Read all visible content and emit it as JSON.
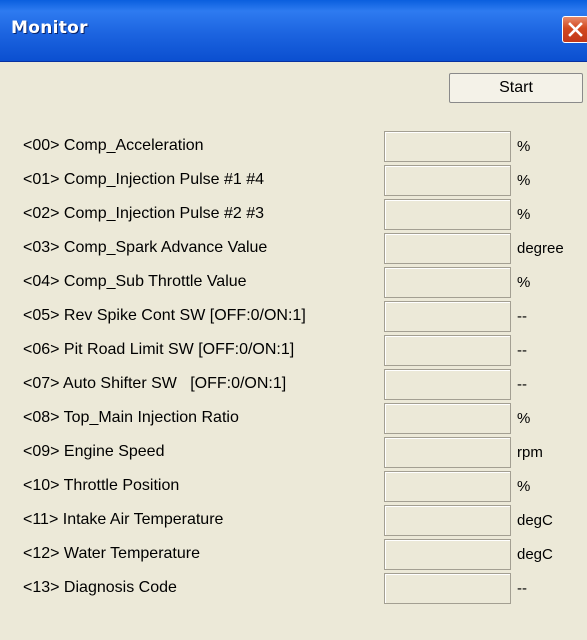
{
  "window": {
    "title": "Monitor",
    "close_icon": "close-icon",
    "accent_color": "#1c64e0",
    "close_color": "#d2491f"
  },
  "toolbar": {
    "start_label": "Start"
  },
  "monitor": {
    "rows": [
      {
        "label": "<00> Comp_Acceleration",
        "value": "",
        "unit": "%"
      },
      {
        "label": "<01> Comp_Injection Pulse #1 #4",
        "value": "",
        "unit": "%"
      },
      {
        "label": "<02> Comp_Injection Pulse #2 #3",
        "value": "",
        "unit": "%"
      },
      {
        "label": "<03> Comp_Spark Advance Value",
        "value": "",
        "unit": "degree"
      },
      {
        "label": "<04> Comp_Sub Throttle Value",
        "value": "",
        "unit": "%"
      },
      {
        "label": "<05> Rev Spike Cont SW [OFF:0/ON:1]",
        "value": "",
        "unit": "--"
      },
      {
        "label": "<06> Pit Road Limit SW [OFF:0/ON:1]",
        "value": "",
        "unit": "--"
      },
      {
        "label": "<07> Auto Shifter SW   [OFF:0/ON:1]",
        "value": "",
        "unit": "--"
      },
      {
        "label": "<08> Top_Main Injection Ratio",
        "value": "",
        "unit": "%"
      },
      {
        "label": "<09> Engine Speed",
        "value": "",
        "unit": "rpm"
      },
      {
        "label": "<10> Throttle Position",
        "value": "",
        "unit": "%"
      },
      {
        "label": "<11> Intake Air Temperature",
        "value": "",
        "unit": "degC"
      },
      {
        "label": "<12> Water Temperature",
        "value": "",
        "unit": "degC"
      },
      {
        "label": "<13> Diagnosis Code",
        "value": "",
        "unit": "--"
      }
    ]
  }
}
